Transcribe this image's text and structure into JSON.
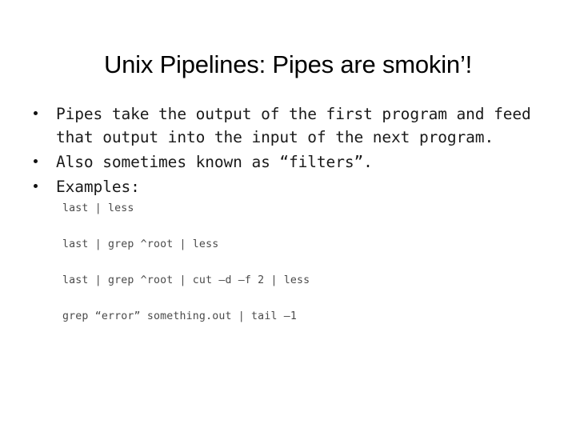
{
  "slide": {
    "title": "Unix Pipelines: Pipes are smokin’!",
    "bullets": [
      {
        "text": "Pipes take the output of the first program and feed that output into the input of the next program."
      },
      {
        "text": "Also sometimes known as “filters”."
      },
      {
        "text": "Examples:"
      }
    ],
    "code_examples": [
      "last | less",
      "last | grep ^root | less",
      "last | grep ^root | cut –d –f 2 | less",
      "grep “error” something.out | tail –1"
    ],
    "colors": {
      "background": "#ffffff",
      "title_text": "#000000",
      "body_text": "#1a1a1a",
      "code_text": "#4a4a4a",
      "bullet_dot": "#111111"
    }
  }
}
